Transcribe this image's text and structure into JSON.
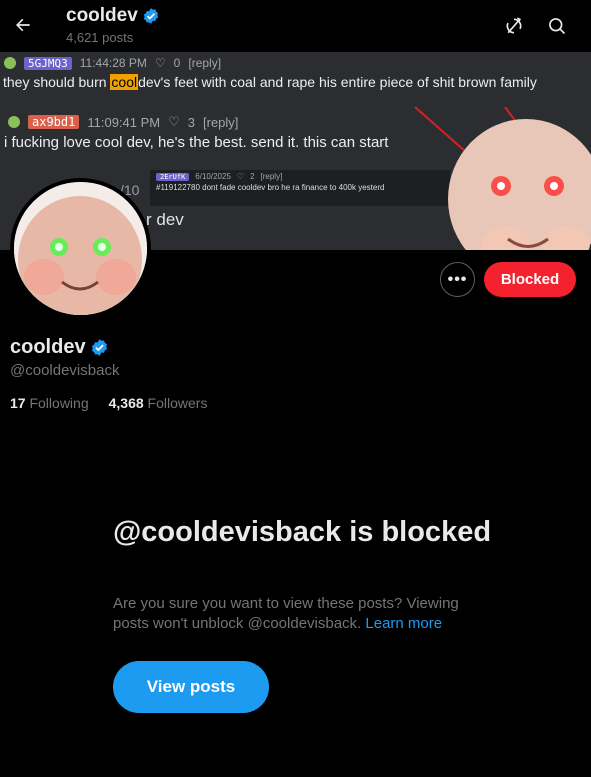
{
  "header": {
    "title": "cooldev",
    "post_count": "4,621 posts"
  },
  "banner": {
    "messages": [
      {
        "tag": "5GJMQ3",
        "tag_color": "#6c62c9",
        "time": "11:44:28 PM",
        "likes": "0",
        "reply": "[reply]",
        "text_before": "they should burn ",
        "highlight": "cool",
        "text_after": "dev's feet with coal and rape his entire piece of shit brown family"
      },
      {
        "tag": "ax9bd1",
        "tag_color": "#d9604b",
        "time": "11:09:41 PM",
        "likes": "3",
        "reply": "[reply]",
        "text": "i fucking love cool dev, he's the best. send it. this can start"
      }
    ],
    "embed": {
      "tag": "2ErUfK",
      "date": "6/10/2025",
      "likes": "2",
      "reply": "[reply]",
      "text": "#119122780 dont fade cooldev bro he ra finance to 400k yesterd"
    },
    "fragment_number": "/10",
    "fragment_text": "r dev"
  },
  "profile": {
    "name": "cooldev",
    "handle": "@cooldevisback",
    "following_count": "17",
    "following_label": "Following",
    "followers_count": "4,368",
    "followers_label": "Followers",
    "blocked_button": "Blocked",
    "more_button": "•••"
  },
  "blocked_notice": {
    "title": "@cooldevisback is blocked",
    "description": "Are you sure you want to view these posts? Viewing posts won't unblock @cooldevisback.",
    "learn_more": "Learn more",
    "view_button": "View posts"
  },
  "colors": {
    "accent": "#1d9bf0",
    "blocked": "#f4212e",
    "verified": "#1d9bf0"
  },
  "icons": [
    "back-arrow-icon",
    "verified-badge-icon",
    "no-notifications-icon",
    "search-icon",
    "more-icon"
  ]
}
